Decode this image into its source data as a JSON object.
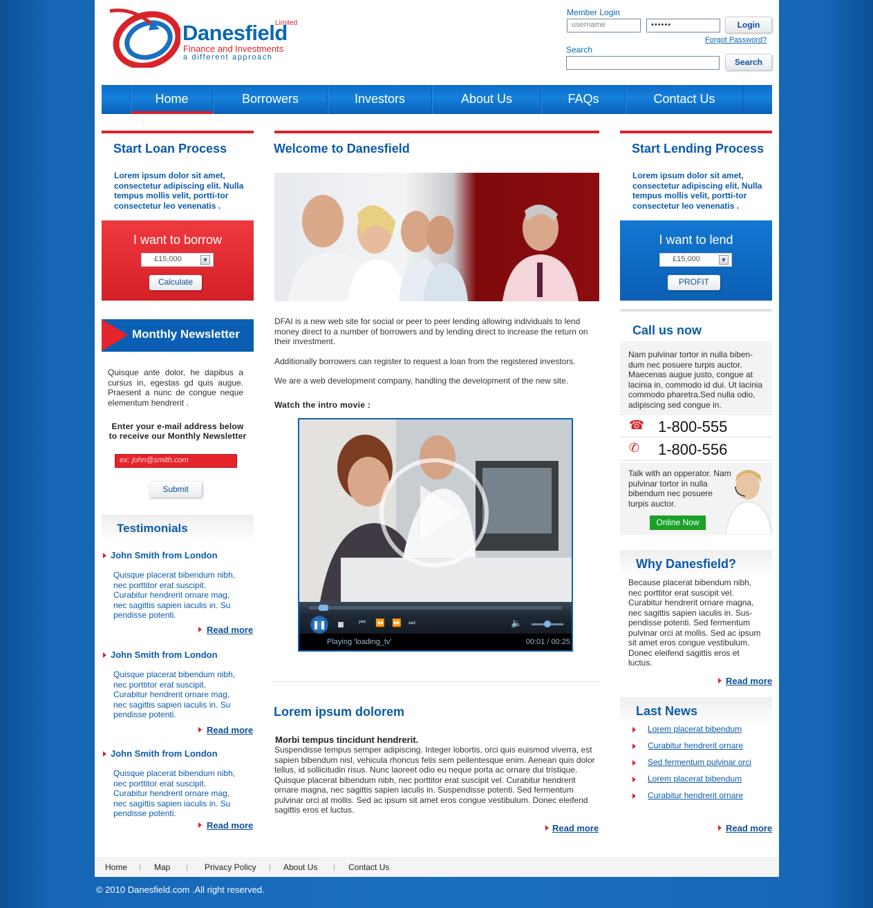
{
  "header": {
    "logo_name": "Danesfield",
    "logo_limited": "Limited",
    "logo_sub": "Finance and Investments",
    "logo_tag": "a different approach",
    "member_login_label": "Member Login",
    "username_placeholder": "username",
    "password_value": "••••••",
    "login_label": "Login",
    "forgot_label": "Forgot Password?",
    "search_label": "Search",
    "search_button": "Search"
  },
  "nav": {
    "items": [
      "Home",
      "Borrowers",
      "Investors",
      "About Us",
      "FAQs",
      "Contact Us"
    ],
    "active": "Home"
  },
  "left": {
    "loan_title": "Start Loan Process",
    "loan_text": "Lorem ipsum dolor sit amet, consectetur adipiscing elit. Nulla tempus mollis velit, portti-tor consectetur leo venenatis .",
    "borrow_title": "I want to borrow",
    "borrow_amount": "£15,000",
    "calculate_label": "Calculate",
    "newsletter_title": "Monthly Newsletter",
    "newsletter_text": "Quisque ante dolor, he dapibus a cursus in, egestas gd quis augue. Praesent a nunc de congue neque elementum hendrerit .",
    "newsletter_prompt_1": "Enter your e-mail address below",
    "newsletter_prompt_2": "to receive our Monthly Newsletter",
    "email_placeholder": "ex: john@smith.com",
    "submit_label": "Submit",
    "testimonials_title": "Testimonials",
    "testimonials": [
      {
        "name": "John Smith from London",
        "text": "Quisque placerat bibendum nibh, nec porttitor erat suscipit. Curabitur hendrerit ornare mag, nec sagittis sapien iaculis in. Su pendisse potenti.",
        "more": "Read more"
      },
      {
        "name": "John Smith from London",
        "text": "Quisque placerat bibendum nibh, nec porttitor erat suscipit. Curabitur hendrerit ornare mag, nec sagittis sapien iaculis in. Su pendisse potenti.",
        "more": "Read more"
      },
      {
        "name": "John Smith from London",
        "text": "Quisque placerat bibendum nibh, nec porttitor erat suscipit. Curabitur hendrerit ornare mag, nec sagittis sapien iaculis in. Su pendisse potenti.",
        "more": "Read more"
      }
    ]
  },
  "center": {
    "welcome_title": "Welcome to Danesfield",
    "para1": "DFAI is a new web site for social or peer to peer lending allowing individuals to lend money direct to a number of borrowers and by lending direct to increase the return on their investment.",
    "para2": "Additionally borrowers can register to request a loan from the registered investors.",
    "para3": "We are a web development company, handling the development of the new site.",
    "watch_title": "Watch the intro movie :",
    "video_status": "Playing 'loading_tv'",
    "video_time": "00:01 / 00:25",
    "lorem_title": "Lorem ipsum dolorem",
    "lorem_sub": "Morbi tempus tincidunt hendrerit.",
    "lorem_text": "Suspendisse tempus semper adipiscing. Integer lobortis, orci quis euismod viverra, est sapien bibendum nisl, vehicula rhoncus felis sem pellentesque enim. Aenean quis dolor tellus, id sollicitudin risus. Nunc laoreet odio eu neque porta ac ornare dui tristique. Quisque placerat bibendum nibh, nec porttitor erat suscipit vel. Curabitur hendrerit ornare magna, nec sagittis sapien iaculis in. Suspendisse potenti. Sed fermentum pulvinar orci at mollis. Sed ac ipsum sit amet eros congue vestibulum. Donec eleifend sagittis eros et luctus.",
    "read_more": "Read more"
  },
  "right": {
    "lending_title": "Start Lending Process",
    "lending_text": "Lorem ipsum dolor sit amet, consectetur adipiscing elit. Nulla tempus mollis velit, portti-tor consectetur leo venenatis .",
    "lend_title": "I want to lend",
    "lend_amount": "£15,000",
    "profit_label": "PROFIT",
    "call_title": "Call us now",
    "call_text": "Nam pulvinar tortor in nulla biben-dum nec posuere turpis auctor. Maecenas augue justo, congue at lacinia in, commodo id dui. Ut lacinia commodo pharetra.Sed nulla odio, adipiscing sed congue in.",
    "phone1": "1-800-555",
    "phone2": "1-800-556",
    "talk_text": "Talk with an opperator. Nam pulvinar tortor in nulla bibendum nec posuere turpis auctor.",
    "online_label": "Online Now",
    "why_title": "Why Danesfield?",
    "why_text": "Because placerat bibendum nibh, nec porttitor erat suscipit vel. Curabitur hendrerit ornare magna, nec sagittis sapien iaculis in. Sus-pendisse potenti. Sed fermentum pulvinar orci at mollis. Sed ac ipsum sit amet eros congue vestibulum. Donec eleifend sagittis eros et luctus.",
    "why_more": "Read more",
    "news_title": "Last News",
    "news": [
      "Lorem placerat bibendum",
      "Curabitur hendrerit ornare",
      "Sed fermentum pulvinar orci",
      "Lorem placerat bibendum",
      "Curabitur hendrerit ornare"
    ],
    "news_more": "Read more"
  },
  "footer": {
    "links": [
      "Home",
      "Map",
      "Privacy Policy",
      "About Us",
      "Contact Us"
    ],
    "copyright": "© 2010 Danesfield.com .All right reserved."
  },
  "colors": {
    "brand_blue": "#0b5aa8",
    "brand_red": "#d9232a",
    "online_green": "#1aa129"
  }
}
